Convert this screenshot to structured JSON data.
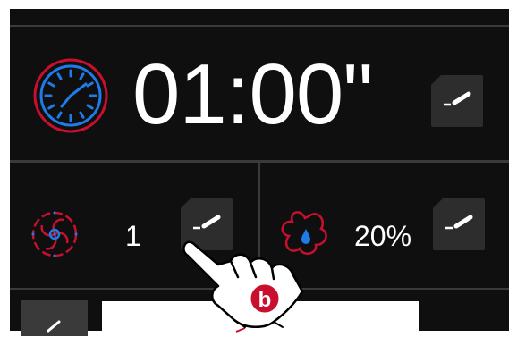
{
  "timer": {
    "value": "01:00\"",
    "icon": "clock-icon"
  },
  "fan": {
    "value": "1",
    "icon": "fan-icon"
  },
  "humidity": {
    "value": "20%",
    "icon": "humidity-icon"
  },
  "edit_icon": "pencil-icon",
  "step_marker": "b",
  "colors": {
    "background": "#0f0f0f",
    "button": "#2d2d2d",
    "accent_red": "#c8102e",
    "accent_blue": "#1e7be8",
    "text": "#ffffff"
  }
}
